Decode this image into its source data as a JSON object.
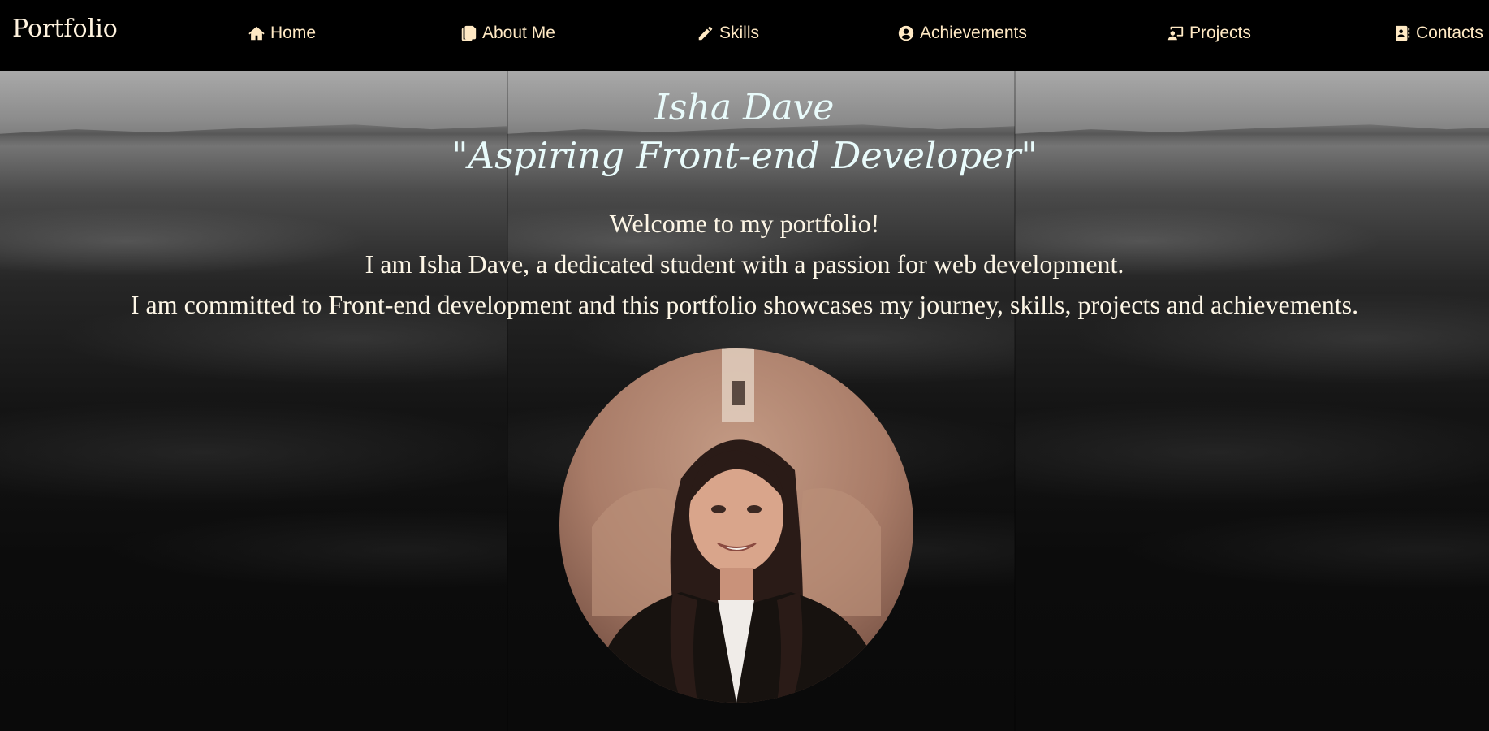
{
  "nav": {
    "brand": "Portfolio",
    "items": [
      {
        "label": "Home",
        "icon": "home-icon"
      },
      {
        "label": "About Me",
        "icon": "copy-icon"
      },
      {
        "label": "Skills",
        "icon": "pencil-icon"
      },
      {
        "label": "Achievements",
        "icon": "user-circle-icon"
      },
      {
        "label": "Projects",
        "icon": "presentation-icon"
      },
      {
        "label": "Contacts",
        "icon": "address-book-icon"
      }
    ]
  },
  "hero": {
    "name": "Isha Dave",
    "tagline": "\"Aspiring Front-end Developer\"",
    "intro": [
      "Welcome to my portfolio!",
      "I am Isha Dave, a dedicated student with a passion for web development.",
      "I am committed to Front-end development and this portfolio showcases my journey, skills, projects and achievements."
    ]
  },
  "colors": {
    "nav_bg": "#000000",
    "nav_text": "#ffe9c4",
    "heading_text": "#e9fbfb",
    "body_text": "#fdf6e6"
  }
}
